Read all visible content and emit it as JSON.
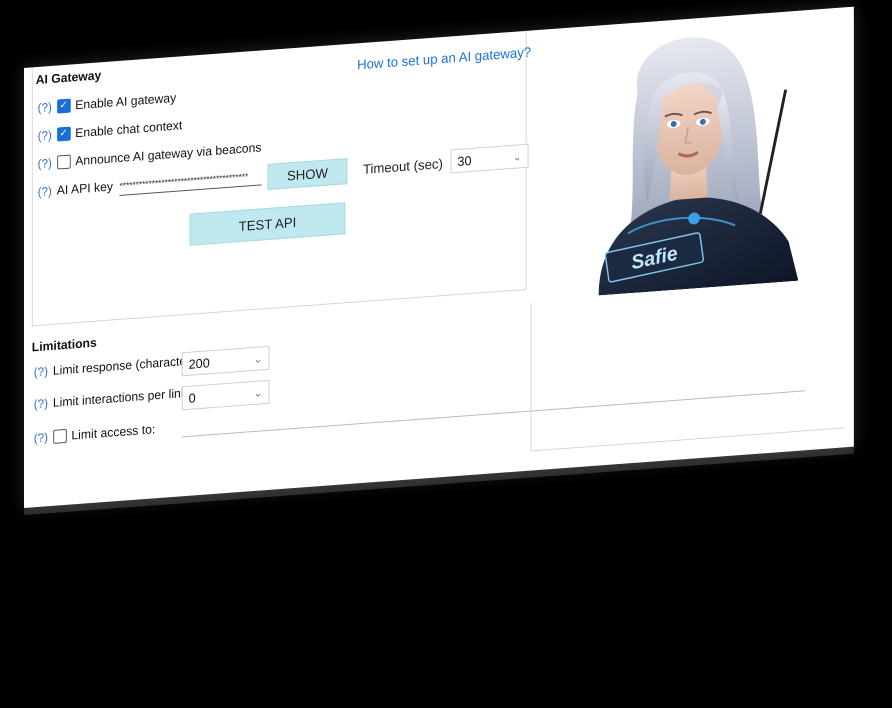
{
  "ai_gateway": {
    "title": "AI Gateway",
    "help_link": "How to set up an AI gateway?",
    "help_marker": "(?)",
    "enable_gateway": {
      "label": "Enable AI gateway",
      "checked": true
    },
    "enable_chat_context": {
      "label": "Enable chat context",
      "checked": true
    },
    "announce_beacons": {
      "label": "Announce AI gateway via beacons",
      "checked": false
    },
    "api_key_label": "AI API key",
    "api_key_value": "****************************************",
    "show_button": "SHOW",
    "timeout_label": "Timeout (sec)",
    "timeout_value": "30",
    "test_button": "TEST API"
  },
  "limitations": {
    "title": "Limitations",
    "help_marker": "(?)",
    "limit_response_label": "Limit response (characters)",
    "limit_response_value": "200",
    "limit_interactions_label": "Limit interactions per link",
    "limit_interactions_value": "0",
    "limit_access": {
      "label": "Limit access to:",
      "checked": false
    }
  },
  "portrait": {
    "badge_text": "Safie"
  },
  "colors": {
    "accent": "#1a6fd6",
    "link": "#1a73d6",
    "button_bg": "#bfe9ee"
  }
}
